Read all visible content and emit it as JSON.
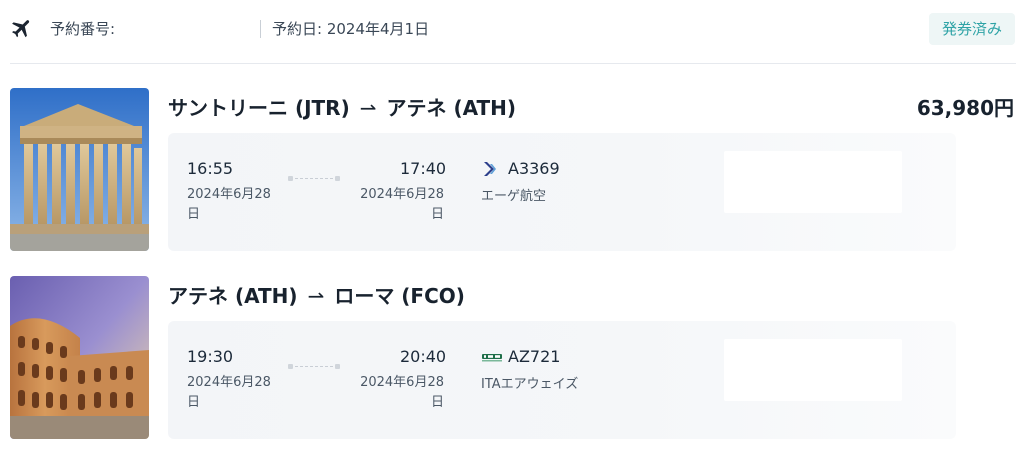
{
  "header": {
    "booking_number_label": "予約番号:",
    "booking_date": "予約日: 2024年4月1日",
    "status": "発券済み"
  },
  "segments": [
    {
      "route_from": "サントリーニ (JTR)",
      "route_arrow": "⇀",
      "route_to": "アテネ (ATH)",
      "price": "63,980円",
      "image": "parthenon-photo",
      "departure_time": "16:55",
      "departure_date": "2024年6月28日",
      "arrival_time": "17:40",
      "arrival_date": "2024年6月28日",
      "flight_number": "A3369",
      "airline": "エーゲ航空",
      "airline_logo": "aegean-logo-icon"
    },
    {
      "route_from": "アテネ (ATH)",
      "route_arrow": "⇀",
      "route_to": "ローマ (FCO)",
      "image": "colosseum-photo",
      "departure_time": "19:30",
      "departure_date": "2024年6月28日",
      "arrival_time": "20:40",
      "arrival_date": "2024年6月28日",
      "flight_number": "AZ721",
      "airline": "ITAエアウェイズ",
      "airline_logo": "ita-logo-icon"
    }
  ]
}
